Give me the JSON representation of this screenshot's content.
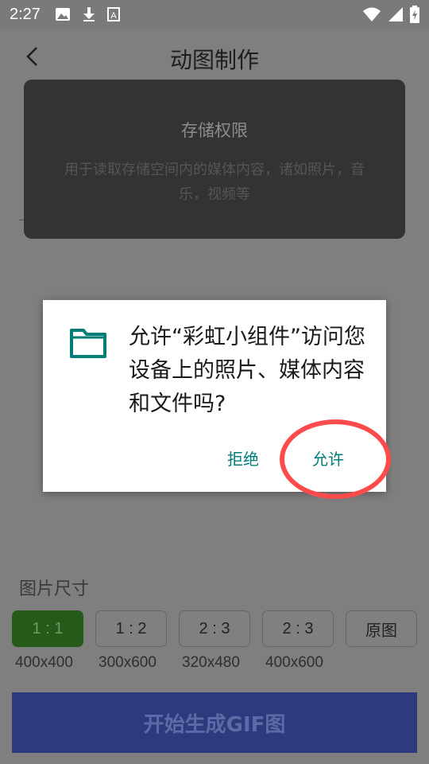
{
  "status_bar": {
    "time": "2:27",
    "icons": [
      "image-icon",
      "download-icon",
      "a-icon",
      "wifi-icon",
      "signal-icon",
      "battery-charging-icon"
    ]
  },
  "app_bar": {
    "title": "动图制作"
  },
  "permission_card": {
    "title": "存储权限",
    "description": "用于读取存储空间内的媒体内容，诸如照片，音乐，视频等"
  },
  "dialog": {
    "message": "允许“彩虹小组件”访问您设备上的照片、媒体内容和文件吗?",
    "deny_label": "拒绝",
    "allow_label": "允许",
    "accent_color": "#017d78"
  },
  "size_section": {
    "label": "图片尺寸",
    "options": [
      {
        "ratio": "1 : 1",
        "dim": "400x400",
        "selected": true
      },
      {
        "ratio": "1 : 2",
        "dim": "300x600",
        "selected": false
      },
      {
        "ratio": "2 : 3",
        "dim": "320x480",
        "selected": false
      },
      {
        "ratio": "2 : 3",
        "dim": "400x600",
        "selected": false
      },
      {
        "ratio": "原图",
        "dim": "",
        "selected": false
      }
    ]
  },
  "generate_button": {
    "label": "开始生成GIF图"
  },
  "colors": {
    "highlight": "#ff4b4b",
    "selected_option": "#255a1a",
    "primary_button": "#2c3a7e"
  }
}
